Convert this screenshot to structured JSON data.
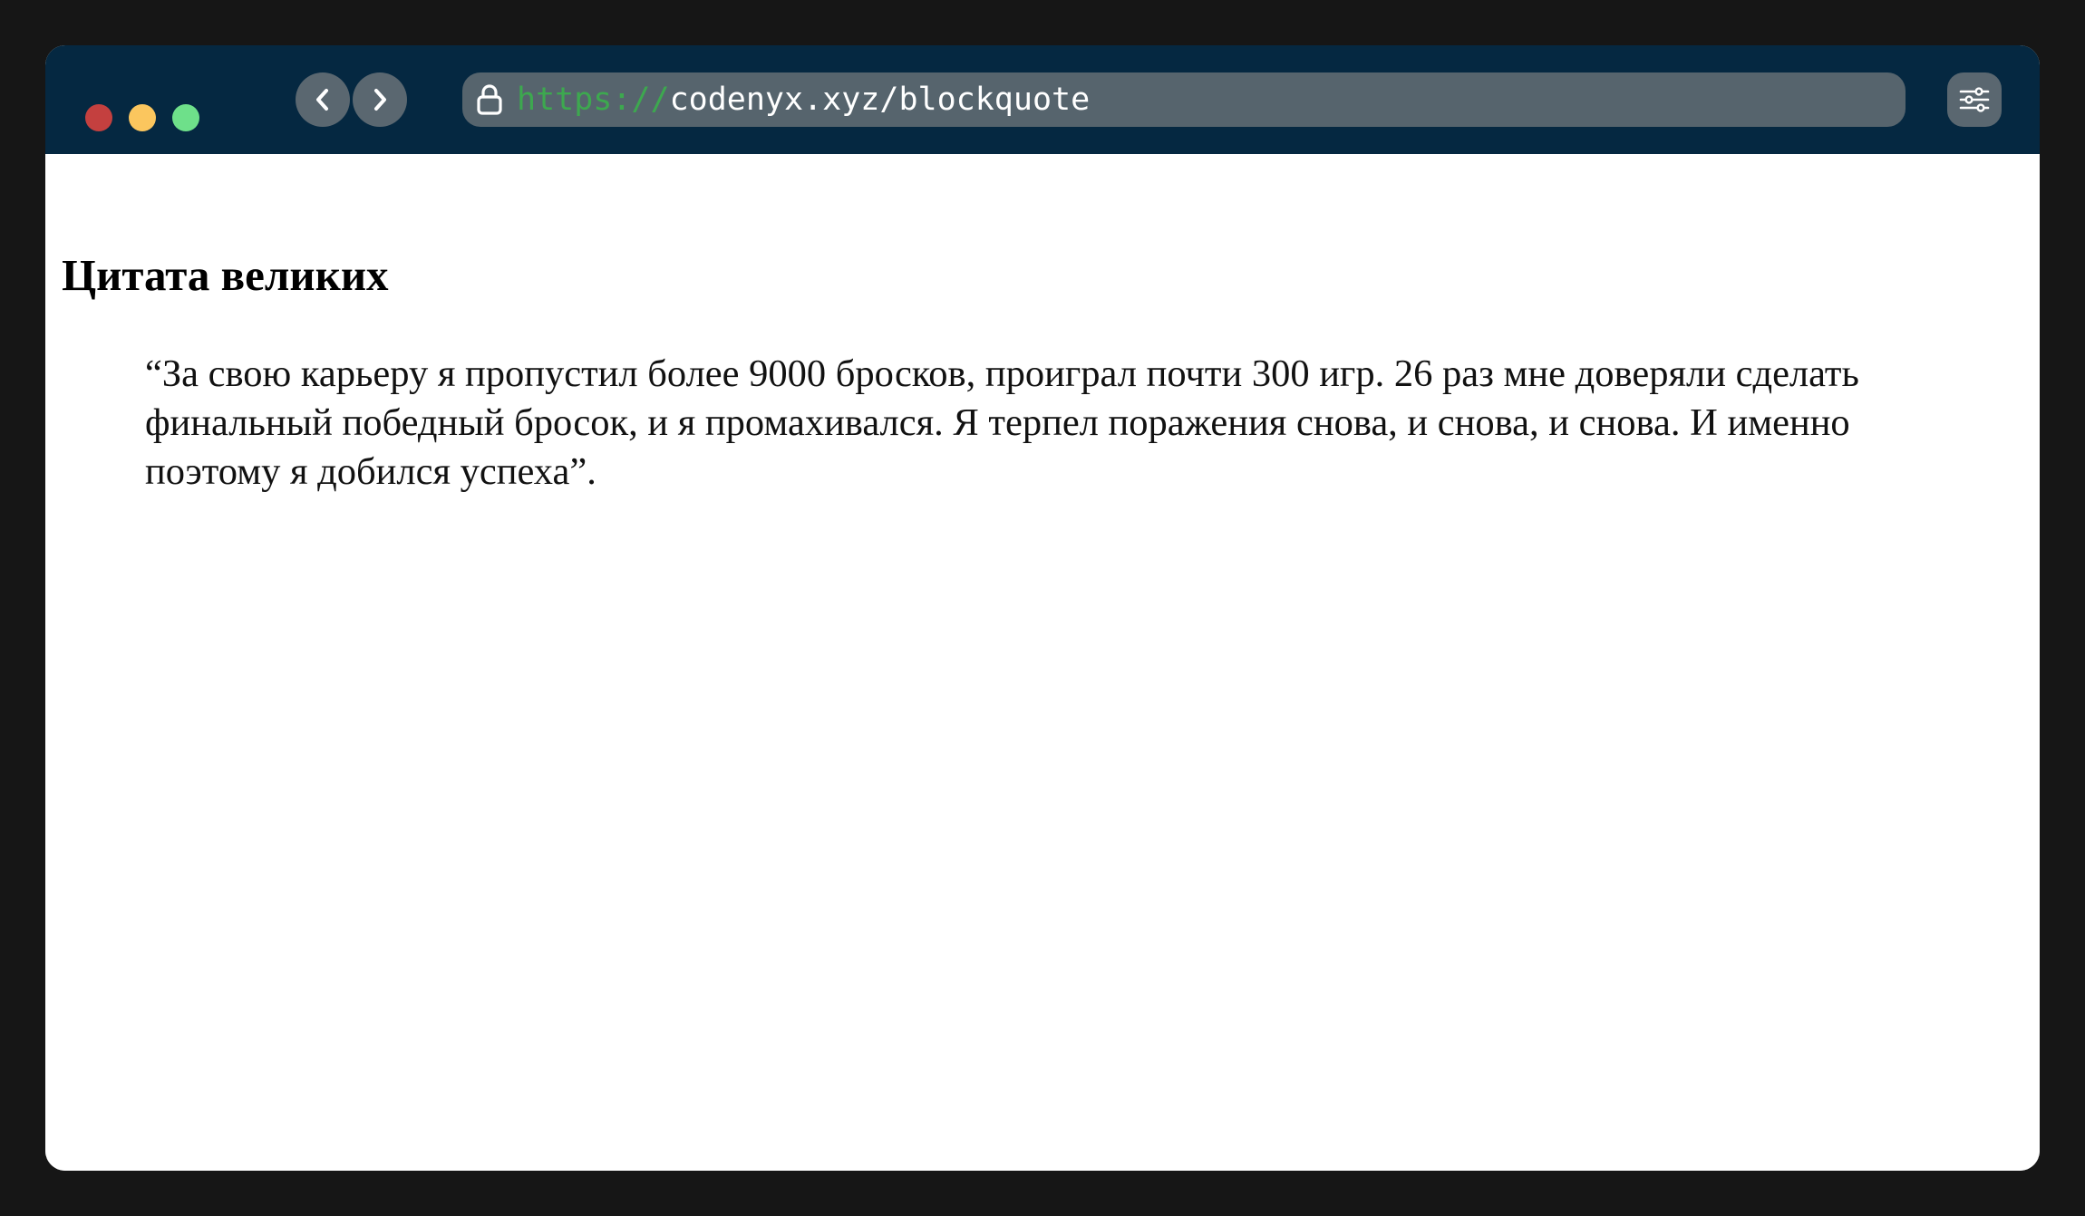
{
  "browser": {
    "url_scheme": "https://",
    "url_rest": "codenyx.xyz/blockquote",
    "icons": {
      "back": "chevron-left-icon",
      "forward": "chevron-right-icon",
      "lock": "lock-icon",
      "settings": "sliders-icon"
    },
    "colors": {
      "titlebar": "#052841",
      "close": "#c4403f",
      "minimize": "#fbc65e",
      "maximize": "#6ee08a",
      "url_scheme": "#3da84f"
    }
  },
  "page": {
    "title": "Цитата великих",
    "quote": "“За свою карьеру я пропустил более 9000 бросков, проиграл почти 300 игр. 26 раз мне доверяли сделать финальный победный бросок, и я промахивался. Я терпел поражения снова, и снова, и снова. И именно поэтому я добился успеха”."
  }
}
